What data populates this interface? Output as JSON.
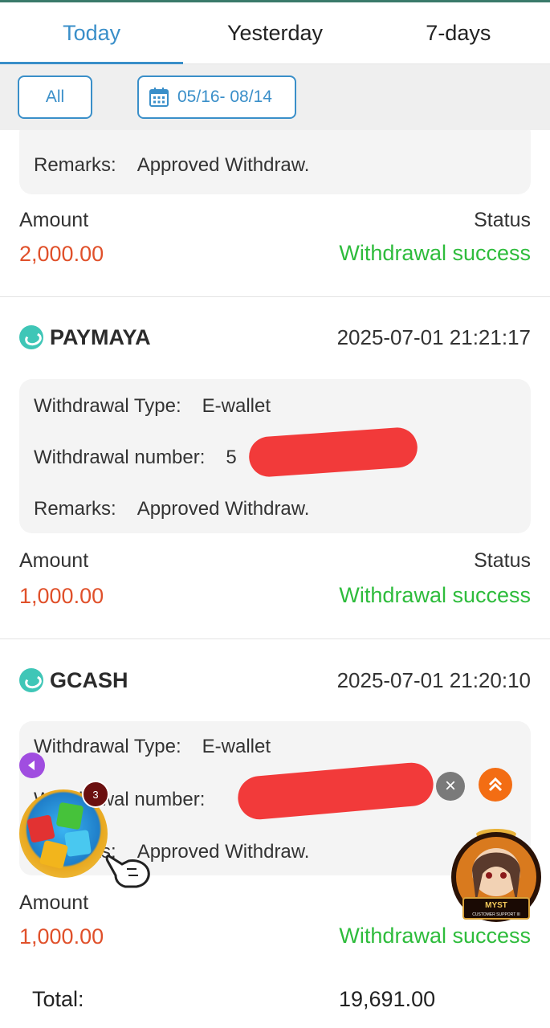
{
  "tabs": {
    "today": "Today",
    "yesterday": "Yesterday",
    "seven_days": "7-days",
    "active": "today"
  },
  "filters": {
    "all_label": "All",
    "date_range": "05/16- 08/14"
  },
  "labels": {
    "withdrawal_type": "Withdrawal Type:",
    "withdrawal_number": "Withdrawal number:",
    "remarks": "Remarks:",
    "amount": "Amount",
    "status": "Status",
    "total": "Total:"
  },
  "records": [
    {
      "remarks": "Approved Withdraw.",
      "amount": "2,000.00",
      "status": "Withdrawal success"
    },
    {
      "method": "PAYMAYA",
      "datetime": "2025-07-01 21:21:17",
      "withdrawal_type": "E-wallet",
      "withdrawal_number_visible": "5",
      "remarks": "Approved Withdraw.",
      "amount": "1,000.00",
      "status": "Withdrawal success"
    },
    {
      "method": "GCASH",
      "datetime": "2025-07-01 21:20:10",
      "withdrawal_type": "E-wallet",
      "remarks": "Approved Withdraw.",
      "amount": "1,000.00",
      "status": "Withdrawal success"
    }
  ],
  "total": "19,691.00",
  "widgets": {
    "game_badge_count": "3",
    "support_text": "MYST",
    "support_subtext": "CUSTOMER SUPPORT III"
  },
  "colors": {
    "accent": "#3a8fc9",
    "amount": "#e0502a",
    "success": "#2ebc3c",
    "brand_icon": "#3fc6b7"
  }
}
